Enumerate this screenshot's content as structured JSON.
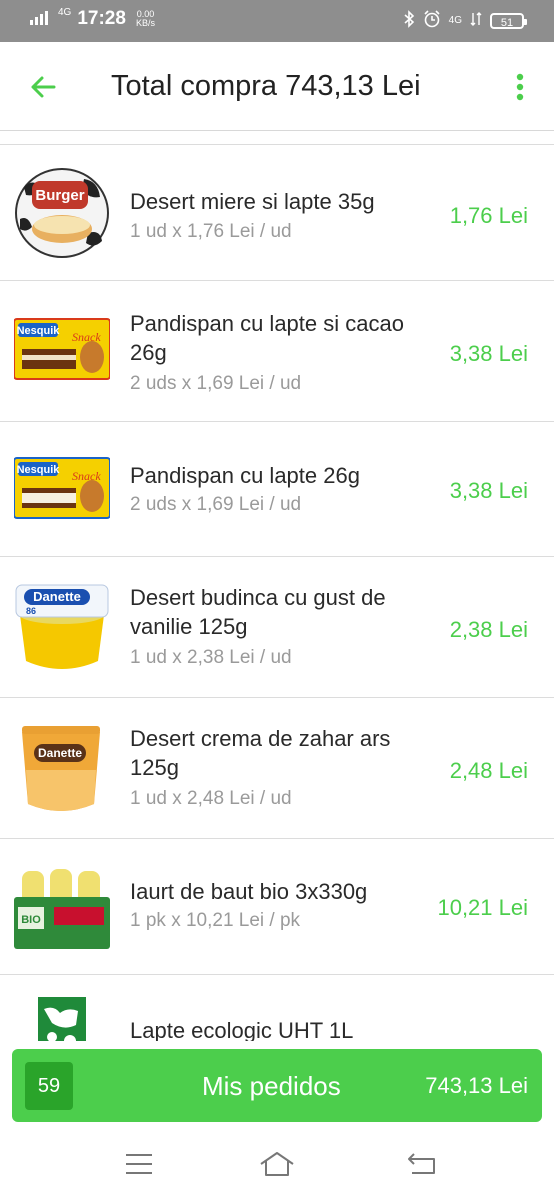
{
  "status_bar": {
    "network": "4G",
    "time": "17:28",
    "speed_value": "0.00",
    "speed_unit": "KB/s",
    "right_network": "4G",
    "battery": "51"
  },
  "header": {
    "title": "Total compra 743,13 Lei",
    "back_icon": "arrow-left-icon",
    "menu_icon": "more-vertical-icon"
  },
  "products": [
    {
      "name": "Desert miere si lapte 35g",
      "qty": "1 ud x 1,76 Lei / ud",
      "price": "1,76 Lei",
      "thumb": "milk-burger-dessert"
    },
    {
      "name": "Pandispan cu lapte si cacao 26g",
      "qty": "2 uds x 1,69 Lei / ud",
      "price": "3,38 Lei",
      "thumb": "nesquik-snack-cacao"
    },
    {
      "name": "Pandispan cu lapte 26g",
      "qty": "2 uds x 1,69 Lei / ud",
      "price": "3,38 Lei",
      "thumb": "nesquik-snack"
    },
    {
      "name": "Desert budinca cu gust de vanilie 125g",
      "qty": "1 ud x 2,38 Lei / ud",
      "price": "2,38 Lei",
      "thumb": "danette-vanilla"
    },
    {
      "name": "Desert crema de zahar ars 125g",
      "qty": "1 ud x 2,48 Lei / ud",
      "price": "2,48 Lei",
      "thumb": "danette-caramel"
    },
    {
      "name": "Iaurt de baut bio 3x330g",
      "qty": "1 pk x 10,21 Lei / pk",
      "price": "10,21 Lei",
      "thumb": "bio-drinking-yogurt-pack"
    },
    {
      "name": "Lapte ecologic UHT 1L",
      "qty": "",
      "price": "",
      "thumb": "organic-milk-carton"
    }
  ],
  "bottom_button": {
    "count": "59",
    "label": "Mis pedidos",
    "total": "743,13 Lei"
  },
  "nav_bar": {
    "icons": [
      "menu-icon",
      "home-icon",
      "back-icon"
    ]
  },
  "colors": {
    "accent": "#4cce4c",
    "accent_dark": "#2aa42a",
    "status_bar": "#8e8e8e"
  }
}
